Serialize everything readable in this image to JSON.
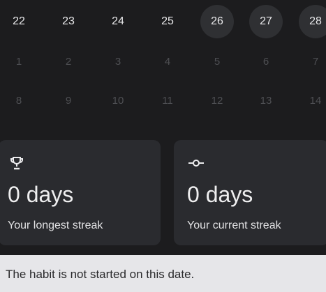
{
  "calendar": {
    "week1": [
      "22",
      "23",
      "24",
      "25",
      "26",
      "27",
      "28"
    ],
    "week2": [
      "1",
      "2",
      "3",
      "4",
      "5",
      "6",
      "7"
    ],
    "week3": [
      "8",
      "9",
      "10",
      "11",
      "12",
      "13",
      "14"
    ]
  },
  "cards": {
    "longest": {
      "icon": "trophy-icon",
      "value": "0 days",
      "label": "Your longest streak"
    },
    "current": {
      "icon": "commit-icon",
      "value": "0 days",
      "label": "Your current streak"
    }
  },
  "status": {
    "message": "The habit is not started on this date."
  },
  "colors": {
    "background": "#1c1c1e",
    "card": "#2a2b2f",
    "active_day": "#2f3033",
    "faded_text": "#4e4f53",
    "status_bar": "#e6e6e9"
  }
}
